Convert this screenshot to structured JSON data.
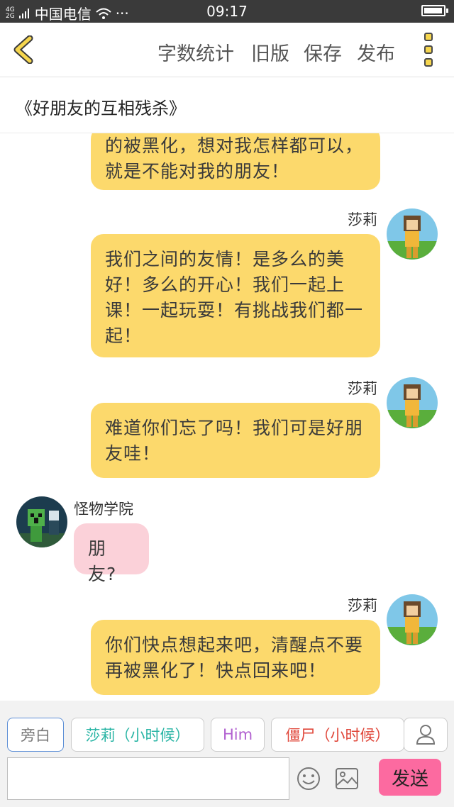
{
  "status_bar": {
    "network_top": "4G",
    "network_bottom": "2G",
    "carrier": "中国电信",
    "more": "···",
    "time": "09:17",
    "battery_level": 0.95
  },
  "toolbar": {
    "word_count": "字数统计",
    "old_version": "旧版",
    "save": "保存",
    "publish": "发布"
  },
  "story_title": "《好朋友的互相残杀》",
  "messages": [
    {
      "text": "的被黑化，想对我怎样都可以，就是不能对我的朋友！"
    },
    {
      "sender": "莎莉",
      "text": "我们之间的友情！是多么的美好！多么的开心！我们一起上课！一起玩耍！有挑战我们都一起！"
    },
    {
      "sender": "莎莉",
      "text": "难道你们忘了吗！我们可是好朋友哇！"
    },
    {
      "sender": "怪物学院",
      "text": "朋友?"
    },
    {
      "sender": "莎莉",
      "text": "你们快点想起来吧，清醒点不要再被黑化了！快点回来吧！"
    }
  ],
  "roles": [
    {
      "label": "旁白",
      "color": "#777777"
    },
    {
      "label": "莎莉（小时候）",
      "color": "#2ab5a5"
    },
    {
      "label": "Him",
      "color": "#b160d0"
    },
    {
      "label": "僵尸（小时候）",
      "color": "#e0473a"
    }
  ],
  "composer": {
    "input_value": "",
    "send": "发送"
  }
}
